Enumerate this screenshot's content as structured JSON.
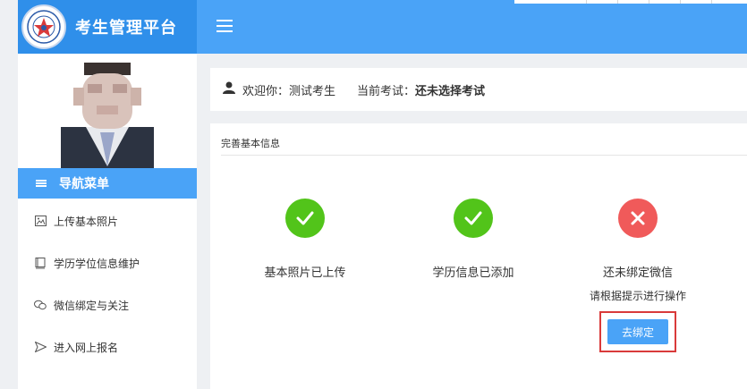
{
  "app": {
    "title": "考生管理平台"
  },
  "colors": {
    "primary": "#4aa3f7",
    "brand_dark": "#2f8fea",
    "success": "#52c41a",
    "error": "#f05a5a",
    "highlight_box": "#d93a3a"
  },
  "sidebar": {
    "nav_header": "导航菜单",
    "items": [
      {
        "label": "上传基本照片",
        "icon": "image-icon"
      },
      {
        "label": "学历学位信息维护",
        "icon": "book-icon"
      },
      {
        "label": "微信绑定与关注",
        "icon": "wechat-icon"
      },
      {
        "label": "进入网上报名",
        "icon": "send-icon"
      }
    ]
  },
  "welcome": {
    "greeting_label": "欢迎你：",
    "user_name": "测试考生",
    "exam_label": "当前考试：",
    "exam_value": "还未选择考试"
  },
  "main": {
    "card_title": "完善基本信息",
    "statuses": [
      {
        "label": "基本照片已上传",
        "state": "done"
      },
      {
        "label": "学历信息已添加",
        "state": "done"
      },
      {
        "label": "还未绑定微信",
        "state": "pending",
        "hint": "请根据提示进行操作"
      }
    ],
    "bind_button": "去绑定"
  }
}
